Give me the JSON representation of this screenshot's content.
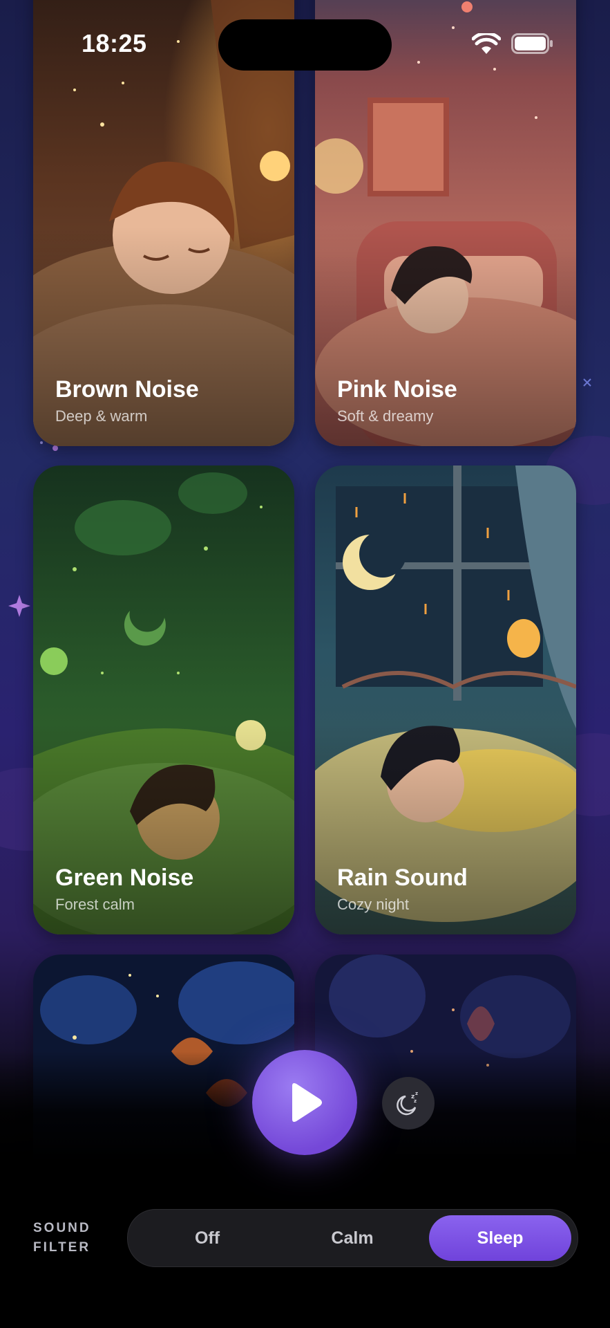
{
  "status_bar": {
    "time": "18:25"
  },
  "sounds": [
    {
      "title": "Brown Noise",
      "subtitle": "Deep & warm"
    },
    {
      "title": "Pink Noise",
      "subtitle": "Soft & dreamy"
    },
    {
      "title": "Green Noise",
      "subtitle": "Forest calm"
    },
    {
      "title": "Rain Sound",
      "subtitle": "Cozy night"
    }
  ],
  "player": {
    "play_icon": "play-icon",
    "sleep_timer_icon": "moon-zzz-icon"
  },
  "filter": {
    "label_line1": "SOUND",
    "label_line2": "FILTER",
    "options": [
      "Off",
      "Calm",
      "Sleep"
    ],
    "selected": "Sleep"
  },
  "colors": {
    "accent": "#7C52E3"
  }
}
